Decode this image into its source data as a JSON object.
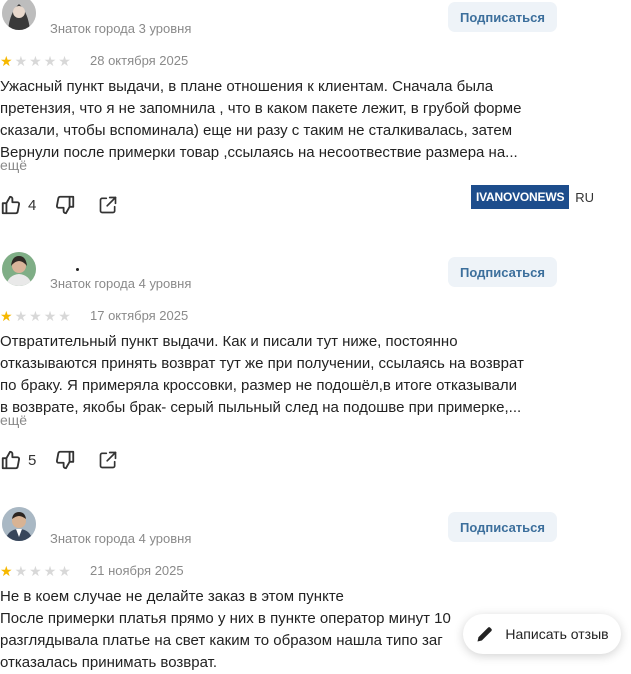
{
  "reviews": [
    {
      "level": "Знаток города 3 уровня",
      "subscribe": "Подписаться",
      "rating": 1,
      "date": "28 октября 2025",
      "text": "Ужасный пункт выдачи, в плане отношения к клиентам. Сначала была\nпретензия, что я не запомнила , что в каком пакете лежит, в грубой форме\nсказали, чтобы вспоминала) еще ни разу с таким не сталкивалась, затем\nВернули после примерки товар ,ссылаясь на несоотвествие размера на...",
      "more": "ещё",
      "likes": "4"
    },
    {
      "level": "Знаток города 4 уровня",
      "subscribe": "Подписаться",
      "rating": 1,
      "date": "17 октября 2025",
      "text": "Отвратительный пункт выдачи. Как и писали тут ниже, постоянно\nотказываются принять возврат тут же при получении, ссылаясь на возврат\nпо браку. Я примеряла кроссовки, размер не подошёл,в итоге отказывали\nв возврате, якобы брак- серый пыльный след на подошве при примерке,...",
      "more": "ещё",
      "likes": "5"
    },
    {
      "level": "Знаток города 4 уровня",
      "subscribe": "Подписаться",
      "rating": 1,
      "date": "21 ноября 2025",
      "text": "Не в коем случае не делайте заказ в этом пункте\nПосле примерки платья прямо у них в пункте оператор минут 10\nразглядывала платье на свет каким то образом нашла типо заг\nотказалась принимать возврат."
    }
  ],
  "watermark": {
    "brand": "IVANOVONEWS",
    "suffix": "RU"
  },
  "write_review": "Написать отзыв",
  "colors": {
    "star": "#f6b800",
    "star_empty": "#d8d8d8",
    "accent": "#3c6f9c",
    "watermark": "#1d4d8c"
  }
}
